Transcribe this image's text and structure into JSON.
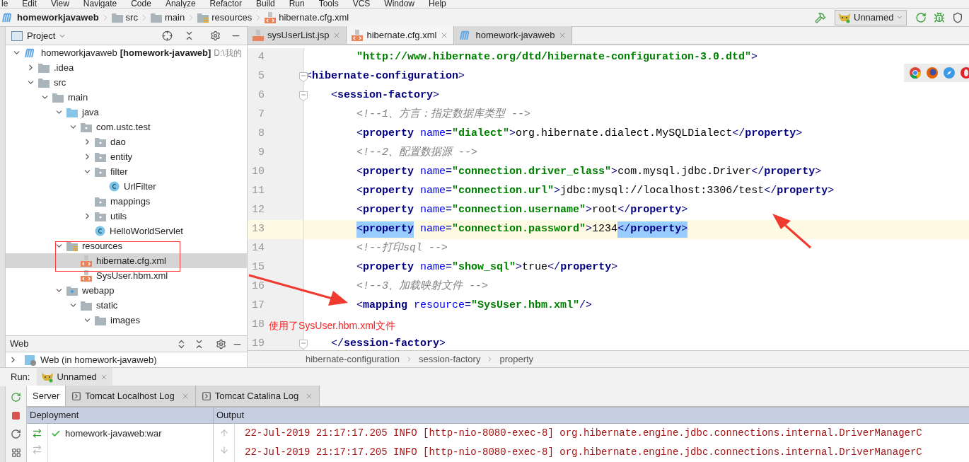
{
  "menu": [
    "le",
    "Edit",
    "View",
    "Navigate",
    "Code",
    "Analyze",
    "Refactor",
    "Build",
    "Run",
    "Tools",
    "VCS",
    "Window",
    "Help"
  ],
  "nav": {
    "crumbs": [
      {
        "text": "homeworkjavaweb",
        "kind": "module"
      },
      {
        "text": "src",
        "kind": "folder"
      },
      {
        "text": "main",
        "kind": "folder"
      },
      {
        "text": "resources",
        "kind": "resources"
      },
      {
        "text": "hibernate.cfg.xml",
        "kind": "xml"
      }
    ],
    "run_config": "Unnamed"
  },
  "project_panel": {
    "title": "Project",
    "tree": [
      {
        "label": "homeworkjavaweb",
        "module": "[homework-javaweb]",
        "path": "D:\\我的",
        "kind": "module",
        "expanded": true,
        "selected": false,
        "children": [
          {
            "label": ".idea",
            "kind": "folder",
            "expanded": false,
            "selected": false
          },
          {
            "label": "src",
            "kind": "folder",
            "expanded": true,
            "selected": false,
            "children": [
              {
                "label": "main",
                "kind": "folder",
                "expanded": true,
                "selected": false,
                "children": [
                  {
                    "label": "java",
                    "kind": "source",
                    "expanded": true,
                    "selected": false,
                    "children": [
                      {
                        "label": "com.ustc.test",
                        "kind": "package",
                        "expanded": true,
                        "selected": false,
                        "children": [
                          {
                            "label": "dao",
                            "kind": "package",
                            "expanded": false,
                            "selected": false
                          },
                          {
                            "label": "entity",
                            "kind": "package",
                            "expanded": false,
                            "selected": false
                          },
                          {
                            "label": "filter",
                            "kind": "package",
                            "expanded": true,
                            "selected": false,
                            "children": [
                              {
                                "label": "UrlFilter",
                                "kind": "class",
                                "selected": false
                              }
                            ]
                          },
                          {
                            "label": "mappings",
                            "kind": "package",
                            "selected": false
                          },
                          {
                            "label": "utils",
                            "kind": "package",
                            "expanded": false,
                            "selected": false
                          },
                          {
                            "label": "HelloWorldServlet",
                            "kind": "class",
                            "selected": false
                          }
                        ]
                      }
                    ]
                  },
                  {
                    "label": "resources",
                    "kind": "resources",
                    "expanded": true,
                    "selected": false,
                    "children": [
                      {
                        "label": "hibernate.cfg.xml",
                        "kind": "xml",
                        "selected": true
                      },
                      {
                        "label": "SysUser.hbm.xml",
                        "kind": "xml",
                        "selected": false
                      }
                    ]
                  },
                  {
                    "label": "webapp",
                    "kind": "webapp",
                    "expanded": true,
                    "selected": false,
                    "children": [
                      {
                        "label": "static",
                        "kind": "folder",
                        "expanded": true,
                        "selected": false,
                        "children": [
                          {
                            "label": "images",
                            "kind": "folder",
                            "expanded": true,
                            "selected": false
                          }
                        ]
                      }
                    ]
                  }
                ]
              }
            ]
          }
        ]
      }
    ]
  },
  "web_panel": {
    "title": "Web",
    "items": [
      {
        "label": "Web (in homework-javaweb)",
        "expanded": false
      }
    ]
  },
  "editor": {
    "tabs": [
      {
        "label": "sysUserList.jsp",
        "kind": "jsp",
        "selected": false
      },
      {
        "label": "hibernate.cfg.xml",
        "kind": "xml",
        "selected": true
      },
      {
        "label": "homework-javaweb",
        "kind": "module",
        "selected": false
      }
    ],
    "lines": [
      {
        "number": "4",
        "kind": "entry",
        "current": false,
        "fold": false,
        "tokens": [
          {
            "kind": "value",
            "text": "\"http://www.hibernate.org/dtd/hibernate-configuration-3.0.dtd\""
          },
          {
            "kind": "punct",
            "text": ">"
          }
        ]
      },
      {
        "number": "5",
        "kind": "root",
        "current": false,
        "fold": true,
        "tokens": [
          {
            "kind": "punct",
            "text": "<"
          },
          {
            "kind": "tag",
            "text": "hibernate-configuration"
          },
          {
            "kind": "punct",
            "text": ">"
          }
        ]
      },
      {
        "number": "6",
        "kind": "section",
        "current": false,
        "fold": true,
        "tokens": [
          {
            "kind": "punct",
            "text": "<"
          },
          {
            "kind": "tag",
            "text": "session-factory"
          },
          {
            "kind": "punct",
            "text": ">"
          }
        ]
      },
      {
        "number": "7",
        "kind": "entry",
        "current": false,
        "fold": false,
        "tokens": [
          {
            "kind": "comment",
            "text": "<!--1、方言：指定数据库类型 -->"
          }
        ]
      },
      {
        "number": "8",
        "kind": "entry",
        "current": false,
        "fold": false,
        "tokens": [
          {
            "kind": "punct",
            "text": "<"
          },
          {
            "kind": "tag",
            "text": "property"
          },
          {
            "kind": "attr",
            "text": "name"
          },
          {
            "kind": "punct",
            "text": "="
          },
          {
            "kind": "value",
            "text": "\"dialect\""
          },
          {
            "kind": "punct",
            "text": ">"
          },
          {
            "kind": "text",
            "text": "org.hibernate.dialect.MySQLDialect"
          },
          {
            "kind": "punct",
            "text": "</"
          },
          {
            "kind": "tag",
            "text": "property"
          },
          {
            "kind": "punct",
            "text": ">"
          }
        ]
      },
      {
        "number": "9",
        "kind": "entry",
        "current": false,
        "fold": false,
        "tokens": [
          {
            "kind": "comment",
            "text": "<!--2、配置数据源 -->"
          }
        ]
      },
      {
        "number": "10",
        "kind": "entry",
        "current": false,
        "fold": false,
        "tokens": [
          {
            "kind": "punct",
            "text": "<"
          },
          {
            "kind": "tag",
            "text": "property"
          },
          {
            "kind": "attr",
            "text": "name"
          },
          {
            "kind": "punct",
            "text": "="
          },
          {
            "kind": "value",
            "text": "\"connection.driver_class\""
          },
          {
            "kind": "punct",
            "text": ">"
          },
          {
            "kind": "text",
            "text": "com.mysql.jdbc.Driver"
          },
          {
            "kind": "punct",
            "text": "</"
          },
          {
            "kind": "tag",
            "text": "property"
          },
          {
            "kind": "punct",
            "text": ">"
          }
        ]
      },
      {
        "number": "11",
        "kind": "entry",
        "current": false,
        "fold": false,
        "tokens": [
          {
            "kind": "punct",
            "text": "<"
          },
          {
            "kind": "tag",
            "text": "property"
          },
          {
            "kind": "attr",
            "text": "name"
          },
          {
            "kind": "punct",
            "text": "="
          },
          {
            "kind": "value",
            "text": "\"connection.url\""
          },
          {
            "kind": "punct",
            "text": ">"
          },
          {
            "kind": "text",
            "text": "jdbc:mysql://localhost:3306/test"
          },
          {
            "kind": "punct",
            "text": "</"
          },
          {
            "kind": "tag",
            "text": "property"
          },
          {
            "kind": "punct",
            "text": ">"
          }
        ]
      },
      {
        "number": "12",
        "kind": "entry",
        "current": false,
        "fold": false,
        "tokens": [
          {
            "kind": "punct",
            "text": "<"
          },
          {
            "kind": "tag",
            "text": "property"
          },
          {
            "kind": "attr",
            "text": "name"
          },
          {
            "kind": "punct",
            "text": "="
          },
          {
            "kind": "value",
            "text": "\"connection.username\""
          },
          {
            "kind": "punct",
            "text": ">"
          },
          {
            "kind": "text",
            "text": "root"
          },
          {
            "kind": "punct",
            "text": "</"
          },
          {
            "kind": "tag",
            "text": "property"
          },
          {
            "kind": "punct",
            "text": ">"
          }
        ]
      },
      {
        "number": "13",
        "kind": "entry",
        "current": true,
        "fold": false,
        "tokens": [
          {
            "kind": "punct_match",
            "text": "<"
          },
          {
            "kind": "tag_match",
            "text": "property"
          },
          {
            "kind": "attr",
            "text": "name"
          },
          {
            "kind": "punct",
            "text": "="
          },
          {
            "kind": "value",
            "text": "\"connection.password\""
          },
          {
            "kind": "punct",
            "text": ">"
          },
          {
            "kind": "text",
            "text": "1234"
          },
          {
            "kind": "punct_match",
            "text": "</"
          },
          {
            "kind": "tag_match",
            "text": "property"
          },
          {
            "kind": "punct_match",
            "text": ">"
          }
        ]
      },
      {
        "number": "14",
        "kind": "entry",
        "current": false,
        "fold": false,
        "tokens": [
          {
            "kind": "comment",
            "text": "<!--打印sql -->"
          }
        ]
      },
      {
        "number": "15",
        "kind": "entry",
        "current": false,
        "fold": false,
        "tokens": [
          {
            "kind": "punct",
            "text": "<"
          },
          {
            "kind": "tag",
            "text": "property"
          },
          {
            "kind": "attr",
            "text": "name"
          },
          {
            "kind": "punct",
            "text": "="
          },
          {
            "kind": "value",
            "text": "\"show_sql\""
          },
          {
            "kind": "punct",
            "text": ">"
          },
          {
            "kind": "text",
            "text": "true"
          },
          {
            "kind": "punct",
            "text": "</"
          },
          {
            "kind": "tag",
            "text": "property"
          },
          {
            "kind": "punct",
            "text": ">"
          }
        ]
      },
      {
        "number": "16",
        "kind": "entry",
        "current": false,
        "fold": false,
        "tokens": [
          {
            "kind": "comment",
            "text": "<!--3、加载映射文件 -->"
          }
        ]
      },
      {
        "number": "17",
        "kind": "entry",
        "current": false,
        "fold": false,
        "tokens": [
          {
            "kind": "punct",
            "text": "<"
          },
          {
            "kind": "tag",
            "text": "mapping"
          },
          {
            "kind": "attr",
            "text": "resource"
          },
          {
            "kind": "punct",
            "text": "="
          },
          {
            "kind": "value",
            "text": "\"SysUser.hbm.xml\""
          },
          {
            "kind": "punct",
            "text": "/>"
          }
        ]
      },
      {
        "number": "18",
        "current": false,
        "fold": false
      },
      {
        "number": "19",
        "kind": "section",
        "current": false,
        "fold": true,
        "tokens": [
          {
            "kind": "punct",
            "text": "</"
          },
          {
            "kind": "tag",
            "text": "session-factory"
          },
          {
            "kind": "punct",
            "text": ">"
          }
        ]
      }
    ],
    "breadcrumbs": [
      "hibernate-configuration",
      "session-factory",
      "property"
    ]
  },
  "annotation": {
    "text": "使用了SysUser.hbm.xml文件"
  },
  "run": {
    "label": "Run:",
    "config_tab": "Unnamed",
    "tabs": [
      {
        "label": "Server",
        "kind": "server",
        "selected": true
      },
      {
        "label": "Tomcat Localhost Log",
        "kind": "log",
        "selected": false
      },
      {
        "label": "Tomcat Catalina Log",
        "kind": "log",
        "selected": false
      }
    ],
    "deployment": {
      "header": "Deployment",
      "items": [
        {
          "label": "homework-javaweb:war"
        }
      ]
    },
    "output": {
      "header": "Output",
      "lines": [
        "22-Jul-2019 21:17:17.205 INFO [http-nio-8080-exec-8] org.hibernate.engine.jdbc.connections.internal.DriverManagerC",
        "22-Jul-2019 21:17:17.205 INFO [http-nio-8080-exec-8] org.hibernate.engine.jdbc.connections.internal.DriverManagerC"
      ]
    }
  }
}
